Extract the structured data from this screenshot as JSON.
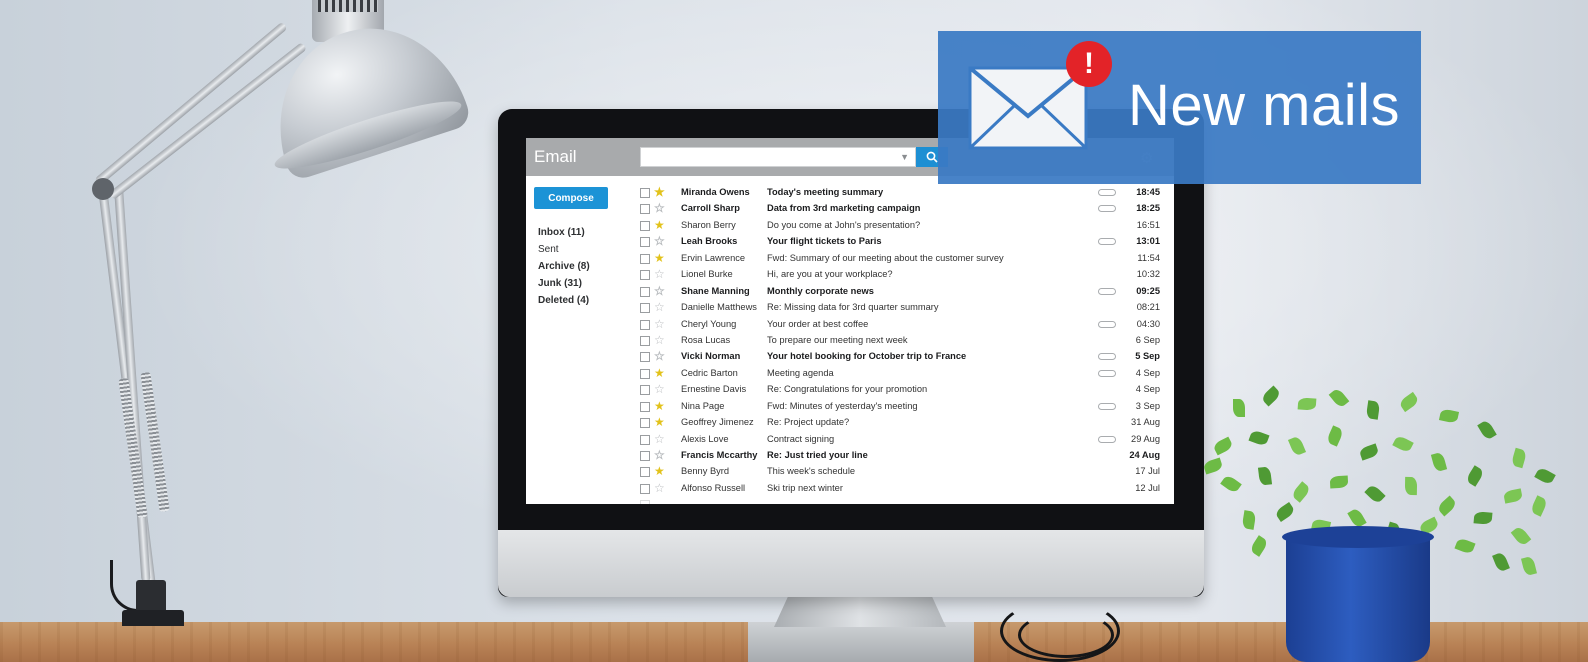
{
  "app": {
    "title": "Email",
    "compose_label": "Compose",
    "search_placeholder": ""
  },
  "folders": [
    {
      "label": "Inbox (11)",
      "bold": true
    },
    {
      "label": "Sent",
      "bold": false
    },
    {
      "label": "Archive (8)",
      "bold": true
    },
    {
      "label": "Junk (31)",
      "bold": true
    },
    {
      "label": "Deleted (4)",
      "bold": true
    }
  ],
  "emails": [
    {
      "sender": "Miranda Owens",
      "subject": "Today's meeting summary",
      "date": "18:45",
      "unread": true,
      "starred": true,
      "attachment": true
    },
    {
      "sender": "Carroll Sharp",
      "subject": "Data from 3rd marketing campaign",
      "date": "18:25",
      "unread": true,
      "starred": false,
      "attachment": true
    },
    {
      "sender": "Sharon Berry",
      "subject": "Do you come at John's presentation?",
      "date": "16:51",
      "unread": false,
      "starred": true,
      "attachment": false
    },
    {
      "sender": "Leah Brooks",
      "subject": "Your flight tickets to Paris",
      "date": "13:01",
      "unread": true,
      "starred": false,
      "attachment": true
    },
    {
      "sender": "Ervin Lawrence",
      "subject": "Fwd: Summary of our meeting about the customer survey",
      "date": "11:54",
      "unread": false,
      "starred": true,
      "attachment": false
    },
    {
      "sender": "Lionel Burke",
      "subject": "Hi, are you at your workplace?",
      "date": "10:32",
      "unread": false,
      "starred": false,
      "attachment": false
    },
    {
      "sender": "Shane Manning",
      "subject": "Monthly corporate news",
      "date": "09:25",
      "unread": true,
      "starred": false,
      "attachment": true
    },
    {
      "sender": "Danielle Matthews",
      "subject": "Re: Missing data for 3rd quarter summary",
      "date": "08:21",
      "unread": false,
      "starred": false,
      "attachment": false
    },
    {
      "sender": "Cheryl Young",
      "subject": "Your order at best coffee",
      "date": "04:30",
      "unread": false,
      "starred": false,
      "attachment": true
    },
    {
      "sender": "Rosa Lucas",
      "subject": "To prepare our meeting next week",
      "date": "6 Sep",
      "unread": false,
      "starred": false,
      "attachment": false
    },
    {
      "sender": "Vicki Norman",
      "subject": "Your hotel booking for October trip to France",
      "date": "5 Sep",
      "unread": true,
      "starred": false,
      "attachment": true
    },
    {
      "sender": "Cedric Barton",
      "subject": "Meeting agenda",
      "date": "4 Sep",
      "unread": false,
      "starred": true,
      "attachment": true
    },
    {
      "sender": "Ernestine Davis",
      "subject": "Re: Congratulations for your promotion",
      "date": "4 Sep",
      "unread": false,
      "starred": false,
      "attachment": false
    },
    {
      "sender": "Nina Page",
      "subject": "Fwd: Minutes of yesterday's meeting",
      "date": "3 Sep",
      "unread": false,
      "starred": true,
      "attachment": true
    },
    {
      "sender": "Geoffrey Jimenez",
      "subject": "Re: Project update?",
      "date": "31 Aug",
      "unread": false,
      "starred": true,
      "attachment": false
    },
    {
      "sender": "Alexis Love",
      "subject": "Contract signing",
      "date": "29 Aug",
      "unread": false,
      "starred": false,
      "attachment": true
    },
    {
      "sender": "Francis Mccarthy",
      "subject": "Re: Just tried your line",
      "date": "24 Aug",
      "unread": true,
      "starred": false,
      "attachment": false
    },
    {
      "sender": "Benny Byrd",
      "subject": "This week's schedule",
      "date": "17 Jul",
      "unread": false,
      "starred": true,
      "attachment": false
    },
    {
      "sender": "Alfonso Russell",
      "subject": "Ski trip next winter",
      "date": "12 Jul",
      "unread": false,
      "starred": false,
      "attachment": false
    }
  ],
  "notification": {
    "text": "New mails",
    "badge": "!"
  },
  "colors": {
    "accent": "#1c93d6",
    "banner": "#3a7ac4",
    "badge": "#e32328",
    "star": "#e2c21a"
  },
  "icons": [
    "search-icon",
    "dropdown-caret-icon",
    "gear-icon",
    "star-icon",
    "checkbox-icon",
    "attachment-icon",
    "envelope-icon",
    "alert-badge-icon"
  ]
}
